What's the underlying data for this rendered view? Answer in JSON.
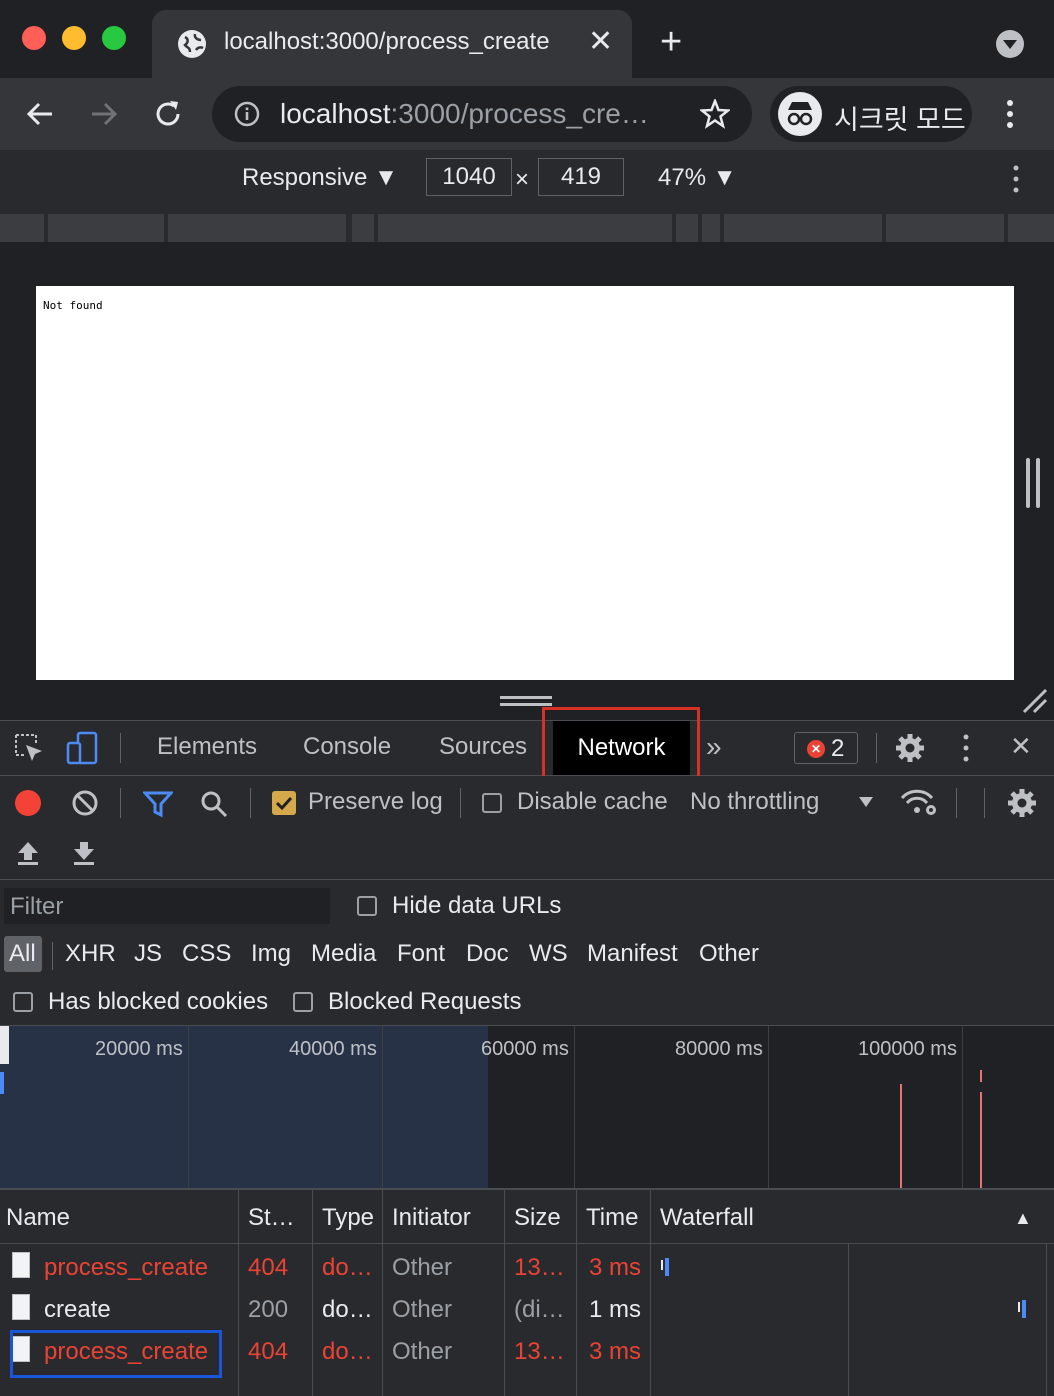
{
  "browser": {
    "tab_title": "localhost:3000/process_create",
    "url_host": "localhost",
    "url_rest": ":3000/process_cre…",
    "incognito_label": "시크릿 모드"
  },
  "device_toolbar": {
    "mode": "Responsive ▼",
    "width": "1040",
    "times": "×",
    "height": "419",
    "zoom": "47% ▼"
  },
  "page": {
    "body_text": "Not found"
  },
  "devtools": {
    "tabs": [
      "Elements",
      "Console",
      "Sources",
      "Network"
    ],
    "more_tabs": "»",
    "error_count": "2",
    "close": "✕"
  },
  "network": {
    "preserve_log": "Preserve log",
    "disable_cache": "Disable cache",
    "throttling": "No throttling",
    "filter_placeholder": "Filter",
    "hide_data_urls": "Hide data URLs",
    "types": [
      "All",
      "XHR",
      "JS",
      "CSS",
      "Img",
      "Media",
      "Font",
      "Doc",
      "WS",
      "Manifest",
      "Other"
    ],
    "has_blocked_cookies": "Has blocked cookies",
    "blocked_requests": "Blocked Requests",
    "overview_ticks": [
      "20000 ms",
      "40000 ms",
      "60000 ms",
      "80000 ms",
      "100000 ms"
    ],
    "columns": [
      "Name",
      "St…",
      "Type",
      "Initiator",
      "Size",
      "Time",
      "Waterfall"
    ],
    "sort_indicator": "▲",
    "rows": [
      {
        "name": "process_create",
        "status": "404",
        "type": "do…",
        "initiator": "Other",
        "size": "13…",
        "time": "3 ms"
      },
      {
        "name": "create",
        "status": "200",
        "type": "do…",
        "initiator": "Other",
        "size": "(di…",
        "time": "1 ms"
      },
      {
        "name": "process_create",
        "status": "404",
        "type": "do…",
        "initiator": "Other",
        "size": "13…",
        "time": "3 ms"
      }
    ]
  },
  "colors": {
    "traffic_red": "#ff5f57",
    "traffic_yellow": "#febc2e",
    "traffic_green": "#28c840",
    "error_red": "#f28b82",
    "highlight_red": "#d93025",
    "highlight_blue": "#1a56db",
    "record_red": "#f44336",
    "accent_blue": "#4c8bf5"
  }
}
